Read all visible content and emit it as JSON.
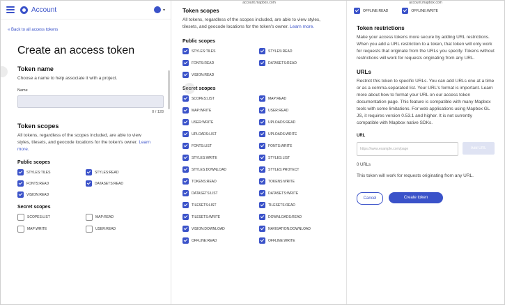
{
  "panel1": {
    "brand": "Account",
    "back_link": "« Back to all access tokens",
    "title": "Create an access token",
    "token_name": {
      "heading": "Token name",
      "help": "Choose a name to help associate it with a project.",
      "field_label": "Name",
      "value": "",
      "counter": "0 / 128"
    },
    "scopes": {
      "heading": "Token scopes",
      "help": "All tokens, regardless of the scopes included, are able to view styles, tilesets, and geocode locations for the token's owner.",
      "learn_more": "Learn more.",
      "public_heading": "Public scopes",
      "public_items": [
        {
          "label": "STYLES:TILES",
          "checked": true
        },
        {
          "label": "STYLES:READ",
          "checked": true
        },
        {
          "label": "FONTS:READ",
          "checked": true
        },
        {
          "label": "DATASETS:READ",
          "checked": true
        },
        {
          "label": "VISION:READ",
          "checked": true
        }
      ],
      "secret_heading": "Secret scopes",
      "secret_items": [
        {
          "label": "SCOPES:LIST",
          "checked": false
        },
        {
          "label": "MAP:READ",
          "checked": false
        },
        {
          "label": "MAP:WRITE",
          "checked": false
        },
        {
          "label": "USER:READ",
          "checked": false
        }
      ]
    }
  },
  "panel2": {
    "url": "account.mapbox.com",
    "heading": "Token scopes",
    "help": "All tokens, regardless of the scopes included, are able to view styles, tilesets, and geocode locations for the token's owner.",
    "learn_more": "Learn more.",
    "public_heading": "Public scopes",
    "public_items": [
      {
        "label": "STYLES:TILES",
        "checked": true
      },
      {
        "label": "STYLES:READ",
        "checked": true
      },
      {
        "label": "FONTS:READ",
        "checked": true
      },
      {
        "label": "DATASETS:READ",
        "checked": true
      },
      {
        "label": "VISION:READ",
        "checked": true
      }
    ],
    "secret_heading": "Secret scopes",
    "secret_items": [
      {
        "label": "SCOPES:LIST",
        "checked": true
      },
      {
        "label": "MAP:READ",
        "checked": true
      },
      {
        "label": "MAP:WRITE",
        "checked": true
      },
      {
        "label": "USER:READ",
        "checked": true
      },
      {
        "label": "USER:WRITE",
        "checked": true
      },
      {
        "label": "UPLOADS:READ",
        "checked": true
      },
      {
        "label": "UPLOADS:LIST",
        "checked": true
      },
      {
        "label": "UPLOADS:WRITE",
        "checked": true
      },
      {
        "label": "FONTS:LIST",
        "checked": true
      },
      {
        "label": "FONTS:WRITE",
        "checked": true
      },
      {
        "label": "STYLES:WRITE",
        "checked": true
      },
      {
        "label": "STYLES:LIST",
        "checked": true
      },
      {
        "label": "STYLES:DOWNLOAD",
        "checked": true
      },
      {
        "label": "STYLES:PROTECT",
        "checked": true
      },
      {
        "label": "TOKENS:READ",
        "checked": true
      },
      {
        "label": "TOKENS:WRITE",
        "checked": true
      },
      {
        "label": "DATASETS:LIST",
        "checked": true
      },
      {
        "label": "DATASETS:WRITE",
        "checked": true
      },
      {
        "label": "TILESETS:LIST",
        "checked": true
      },
      {
        "label": "TILESETS:READ",
        "checked": true
      },
      {
        "label": "TILESETS:WRITE",
        "checked": true
      },
      {
        "label": "DOWNLOADS:READ",
        "checked": true
      },
      {
        "label": "VISION:DOWNLOAD",
        "checked": true
      },
      {
        "label": "NAVIGATION:DOWNLOAD",
        "checked": true
      },
      {
        "label": "OFFLINE:READ",
        "checked": true
      },
      {
        "label": "OFFLINE:WRITE",
        "checked": true
      }
    ]
  },
  "panel3": {
    "url": "account.mapbox.com",
    "top_items": [
      {
        "label": "OFFLINE:READ",
        "checked": true
      },
      {
        "label": "OFFLINE:WRITE",
        "checked": true
      }
    ],
    "restrictions_heading": "Token restrictions",
    "restrictions_help": "Make your access tokens more secure by adding URL restrictions. When you add a URL restriction to a token, that token will only work for requests that originate from the URLs you specify. Tokens without restrictions will work for requests originating from any URL.",
    "urls_heading": "URLs",
    "urls_help": "Restrict this token to specific URLs. You can add URLs one at a time or as a comma-separated list. Your URL's format is important. Learn more about how to format your URL on our access token documentation page. This feature is compatible with many Mapbox tools with some limitations. For web applications using Mapbox GL JS, it requires version 0.53.1 and higher. It is not currently compatible with Mapbox native SDKs.",
    "url_label": "URL",
    "url_placeholder": "https://www.example.com/page",
    "add_button": "Add URL",
    "url_count": "0 URLs",
    "summary": "This token will work for requests originating from any URL.",
    "cancel": "Cancel",
    "create": "Create token"
  }
}
